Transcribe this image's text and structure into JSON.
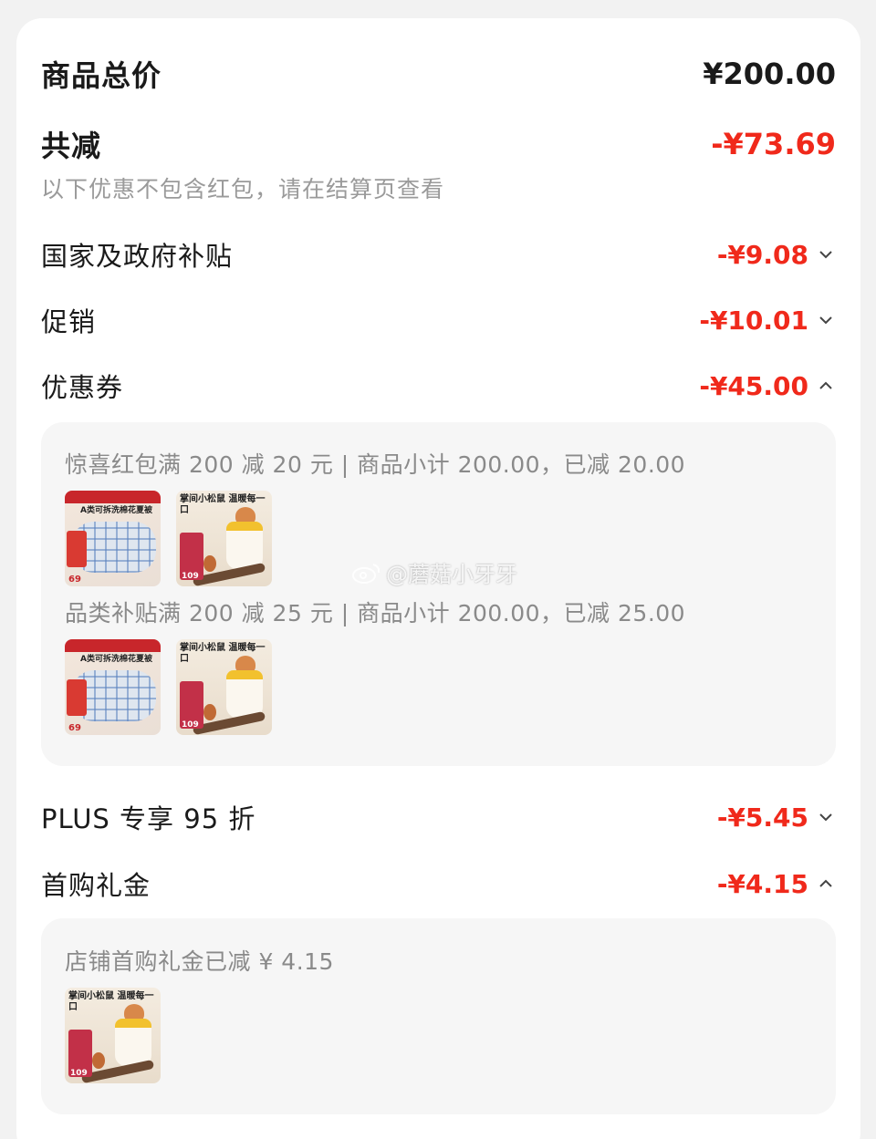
{
  "summary": {
    "total_label": "商品总价",
    "total_value": "¥200.00",
    "discount_label": "共减",
    "discount_value": "-¥73.69",
    "note": "以下优惠不包含红包，请在结算页查看"
  },
  "items": [
    {
      "label": "国家及政府补贴",
      "amount": "-¥9.08",
      "expanded": false
    },
    {
      "label": "促销",
      "amount": "-¥10.01",
      "expanded": false
    },
    {
      "label": "优惠券",
      "amount": "-¥45.00",
      "expanded": true
    },
    {
      "label": "PLUS 专享 95 折",
      "amount": "-¥5.45",
      "expanded": false
    },
    {
      "label": "首购礼金",
      "amount": "-¥4.15",
      "expanded": true
    }
  ],
  "coupon_panel": {
    "lines": [
      "惊喜红包满 200 减 20 元 | 商品小计 200.00，已减 20.00",
      "品类补贴满 200 减 25 元 | 商品小计 200.00，已减 25.00"
    ]
  },
  "gift_panel": {
    "line": "店铺首购礼金已减 ¥ 4.15"
  },
  "thumbs": {
    "quilt_top": "A类可拆洗棉花夏被",
    "quilt_price": "69",
    "squirrel_title": "掌间小松鼠 温暖每一口",
    "squirrel_price": "109"
  },
  "watermark": "@蘑菇小牙牙",
  "colors": {
    "accent_red": "#f0291b",
    "muted": "#9a9a9a"
  }
}
